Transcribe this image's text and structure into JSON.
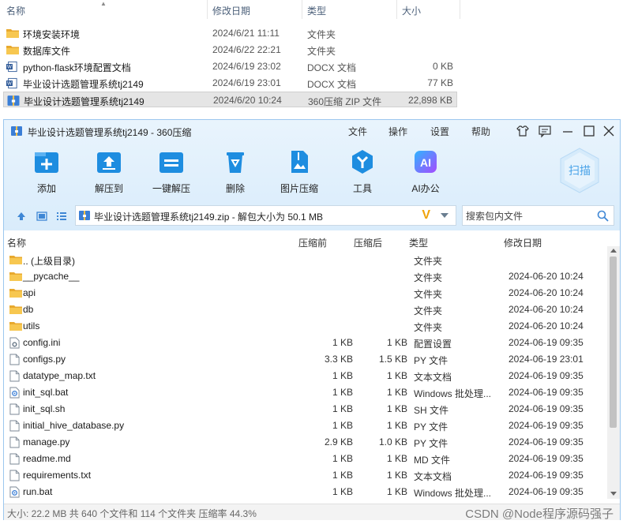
{
  "explorer": {
    "columns": [
      "名称",
      "修改日期",
      "类型",
      "大小"
    ],
    "rows": [
      {
        "name": "环境安装环境",
        "date": "2024/6/21 11:11",
        "type": "文件夹",
        "size": "",
        "icon": "folder-icon"
      },
      {
        "name": "数据库文件",
        "date": "2024/6/22 22:21",
        "type": "文件夹",
        "size": "",
        "icon": "folder-icon"
      },
      {
        "name": "python-flask环境配置文档",
        "date": "2024/6/19 23:02",
        "type": "DOCX 文档",
        "size": "0 KB",
        "icon": "word-doc-icon"
      },
      {
        "name": "毕业设计选题管理系统tj2149",
        "date": "2024/6/19 23:01",
        "type": "DOCX 文档",
        "size": "77 KB",
        "icon": "word-doc-icon"
      },
      {
        "name": "毕业设计选题管理系统tj2149",
        "date": "2024/6/20 10:24",
        "type": "360压缩 ZIP 文件",
        "size": "22,898 KB",
        "icon": "zip-archive-icon"
      }
    ]
  },
  "zip_window": {
    "title": "毕业设计选题管理系统tj2149 - 360压缩",
    "menu": [
      "文件",
      "操作",
      "设置",
      "帮助"
    ],
    "toolbar": [
      {
        "label": "添加",
        "icon": "add-icon"
      },
      {
        "label": "解压到",
        "icon": "extract-to-icon"
      },
      {
        "label": "一键解压",
        "icon": "one-click-extract-icon"
      },
      {
        "label": "删除",
        "icon": "delete-icon"
      },
      {
        "label": "图片压缩",
        "icon": "image-compress-icon"
      },
      {
        "label": "工具",
        "icon": "tools-icon"
      },
      {
        "label": "AI办公",
        "icon": "ai-office-icon"
      }
    ],
    "scan_label": "扫描",
    "path": "毕业设计选题管理系统tj2149.zip - 解包大小为 50.1 MB",
    "search_placeholder": "搜索包内文件",
    "columns": [
      "名称",
      "压缩前",
      "压缩后",
      "类型",
      "修改日期"
    ],
    "rows": [
      {
        "name": ".. (上级目录)",
        "orig": "",
        "comp": "",
        "type": "文件夹",
        "date": "",
        "icon": "folder-icon"
      },
      {
        "name": "__pycache__",
        "orig": "",
        "comp": "",
        "type": "文件夹",
        "date": "2024-06-20 10:24",
        "icon": "folder-icon"
      },
      {
        "name": "api",
        "orig": "",
        "comp": "",
        "type": "文件夹",
        "date": "2024-06-20 10:24",
        "icon": "folder-icon"
      },
      {
        "name": "db",
        "orig": "",
        "comp": "",
        "type": "文件夹",
        "date": "2024-06-20 10:24",
        "icon": "folder-icon"
      },
      {
        "name": "utils",
        "orig": "",
        "comp": "",
        "type": "文件夹",
        "date": "2024-06-20 10:24",
        "icon": "folder-icon"
      },
      {
        "name": "config.ini",
        "orig": "1 KB",
        "comp": "1 KB",
        "type": "配置设置",
        "date": "2024-06-19 09:35",
        "icon": "settings-file-icon"
      },
      {
        "name": "configs.py",
        "orig": "3.3 KB",
        "comp": "1.5 KB",
        "type": "PY 文件",
        "date": "2024-06-19 23:01",
        "icon": "file-icon"
      },
      {
        "name": "datatype_map.txt",
        "orig": "1 KB",
        "comp": "1 KB",
        "type": "文本文档",
        "date": "2024-06-19 09:35",
        "icon": "file-icon"
      },
      {
        "name": "init_sql.bat",
        "orig": "1 KB",
        "comp": "1 KB",
        "type": "Windows 批处理...",
        "date": "2024-06-19 09:35",
        "icon": "batch-file-icon"
      },
      {
        "name": "init_sql.sh",
        "orig": "1 KB",
        "comp": "1 KB",
        "type": "SH 文件",
        "date": "2024-06-19 09:35",
        "icon": "file-icon"
      },
      {
        "name": "initial_hive_database.py",
        "orig": "1 KB",
        "comp": "1 KB",
        "type": "PY 文件",
        "date": "2024-06-19 09:35",
        "icon": "file-icon"
      },
      {
        "name": "manage.py",
        "orig": "2.9 KB",
        "comp": "1.0 KB",
        "type": "PY 文件",
        "date": "2024-06-19 09:35",
        "icon": "file-icon"
      },
      {
        "name": "readme.md",
        "orig": "1 KB",
        "comp": "1 KB",
        "type": "MD 文件",
        "date": "2024-06-19 09:35",
        "icon": "file-icon"
      },
      {
        "name": "requirements.txt",
        "orig": "1 KB",
        "comp": "1 KB",
        "type": "文本文档",
        "date": "2024-06-19 09:35",
        "icon": "file-icon"
      },
      {
        "name": "run.bat",
        "orig": "1 KB",
        "comp": "1 KB",
        "type": "Windows 批处理...",
        "date": "2024-06-19 09:35",
        "icon": "batch-file-icon"
      }
    ],
    "status": "大小: 22.2 MB 共 640 个文件和 114 个文件夹 压缩率 44.3%"
  },
  "watermark": "CSDN @Node程序源码强子",
  "colors": {
    "accent": "#1e8de0",
    "folder": "#f5c04a",
    "band": "#e2f0fc"
  }
}
